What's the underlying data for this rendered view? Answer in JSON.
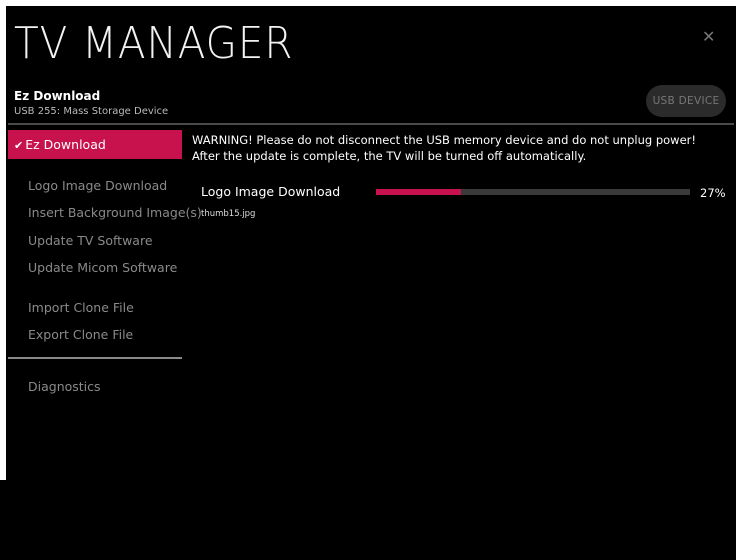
{
  "app": {
    "title": "TV MANAGER"
  },
  "header": {
    "section_name": "Ez Download",
    "device_name": "USB 255: Mass Storage Device",
    "usb_button_label": "USB DEVICE",
    "close_icon": "close-icon"
  },
  "sidebar": {
    "active_item": "Ez Download",
    "items": [
      "Logo Image Download",
      "Insert Background Image(s)",
      "Update TV Software",
      "Update Micom Software",
      "Import Clone File",
      "Export Clone File",
      "Diagnostics"
    ]
  },
  "main": {
    "warning_line1": "WARNING! Please do not disconnect the USB memory device and do not unplug power!",
    "warning_line2": "After the update is complete, the TV will be turned off automatically.",
    "download_label": "Logo Image Download",
    "progress_percent": 27,
    "progress_text": "27%",
    "file_name": "thumb15.jpg"
  },
  "colors": {
    "accent": "#c8124e",
    "background": "#000000",
    "muted_text": "#8a8a8a"
  }
}
